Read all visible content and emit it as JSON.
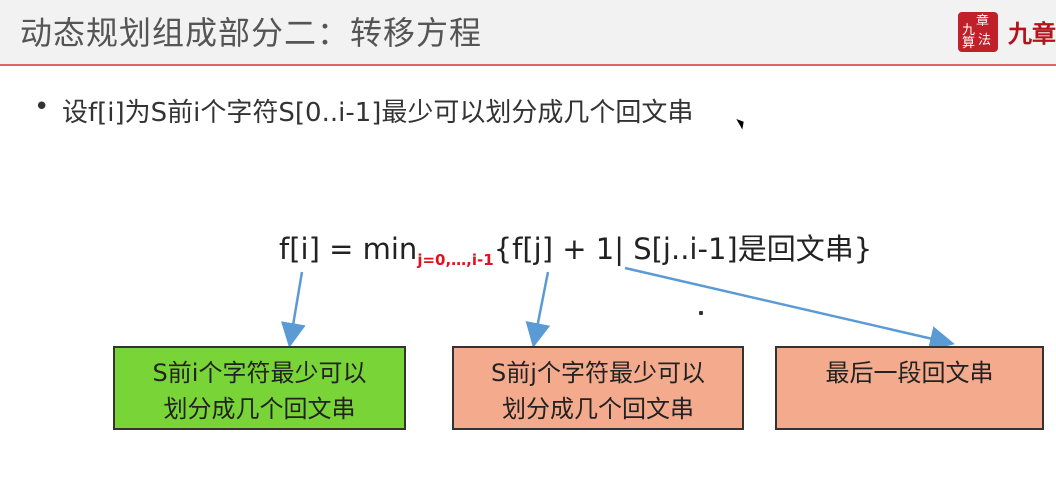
{
  "header": {
    "title": "动态规划组成部分二：转移方程",
    "logo_seal_chars": [
      "九",
      "章",
      "算",
      "法"
    ],
    "logo_text": "九章"
  },
  "bullet": {
    "symbol": "•",
    "text": "设f[i]为S前i个字符S[0..i-1]最少可以划分成几个回文串"
  },
  "formula": {
    "lhs": "f[i] = min",
    "subscript": "j=0,…,i-1",
    "rhs": "{f[j] + 1| S[j..i-1]是回文串}"
  },
  "boxes": [
    {
      "line1": "S前i个字符最少可以",
      "line2": "划分成几个回文串",
      "color": "#78d437"
    },
    {
      "line1": "S前j个字符最少可以",
      "line2": "划分成几个回文串",
      "color": "#f4ab8d"
    },
    {
      "line1": "最后一段回文串",
      "line2": "",
      "color": "#f4ab8d"
    }
  ],
  "colors": {
    "accent_rule": "#e06666",
    "subscript_red": "#e2111b",
    "arrow_blue": "#5b9bd5"
  }
}
